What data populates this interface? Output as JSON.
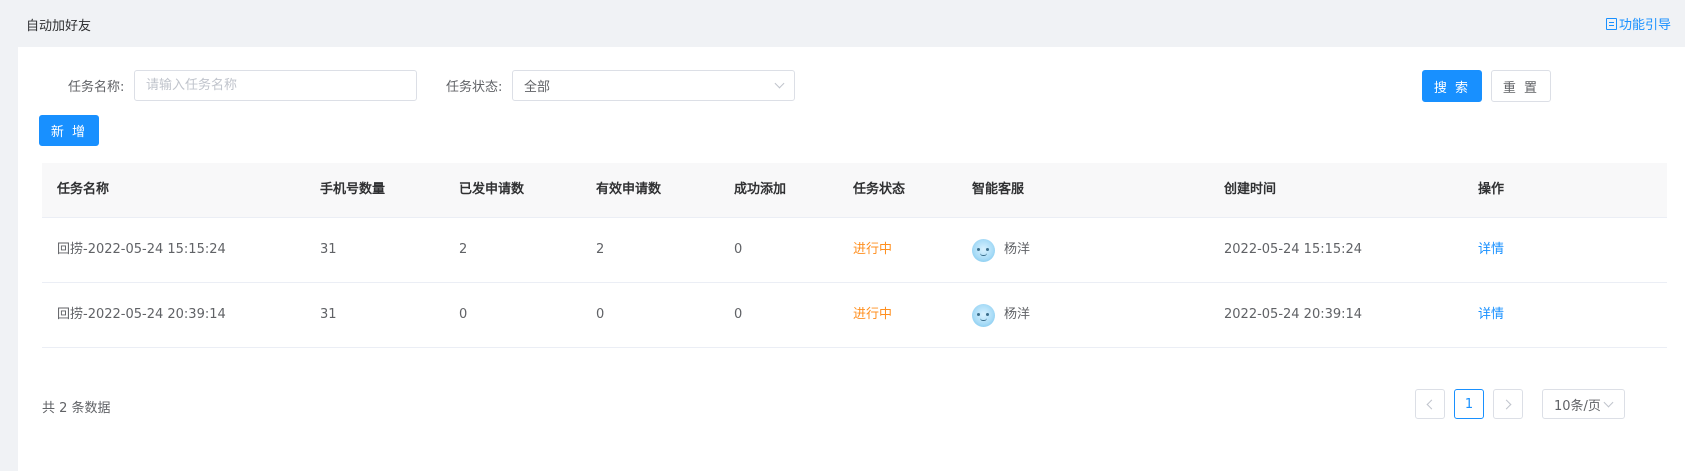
{
  "header": {
    "title": "自动加好友",
    "guide_label": "功能引导"
  },
  "filters": {
    "task_name_label": "任务名称:",
    "task_name_placeholder": "请输入任务名称",
    "task_name_value": "",
    "task_status_label": "任务状态:",
    "task_status_value": "全部"
  },
  "buttons": {
    "search": "搜 索",
    "reset": "重 置",
    "add": "新 增"
  },
  "table": {
    "columns": [
      "任务名称",
      "手机号数量",
      "已发申请数",
      "有效申请数",
      "成功添加",
      "任务状态",
      "智能客服",
      "创建时间",
      "操作"
    ],
    "rows": [
      {
        "name": "回捞-2022-05-24 15:15:24",
        "phone_count": "31",
        "sent": "2",
        "valid": "2",
        "added": "0",
        "status": "进行中",
        "agent": "杨洋",
        "created": "2022-05-24 15:15:24",
        "action": "详情"
      },
      {
        "name": "回捞-2022-05-24 20:39:14",
        "phone_count": "31",
        "sent": "0",
        "valid": "0",
        "added": "0",
        "status": "进行中",
        "agent": "杨洋",
        "created": "2022-05-24 20:39:14",
        "action": "详情"
      }
    ]
  },
  "pagination": {
    "total_text": "共 2 条数据",
    "current_page": "1",
    "page_size": "10条/页"
  },
  "colors": {
    "primary": "#1890ff",
    "status_running": "#ff8f1f"
  }
}
